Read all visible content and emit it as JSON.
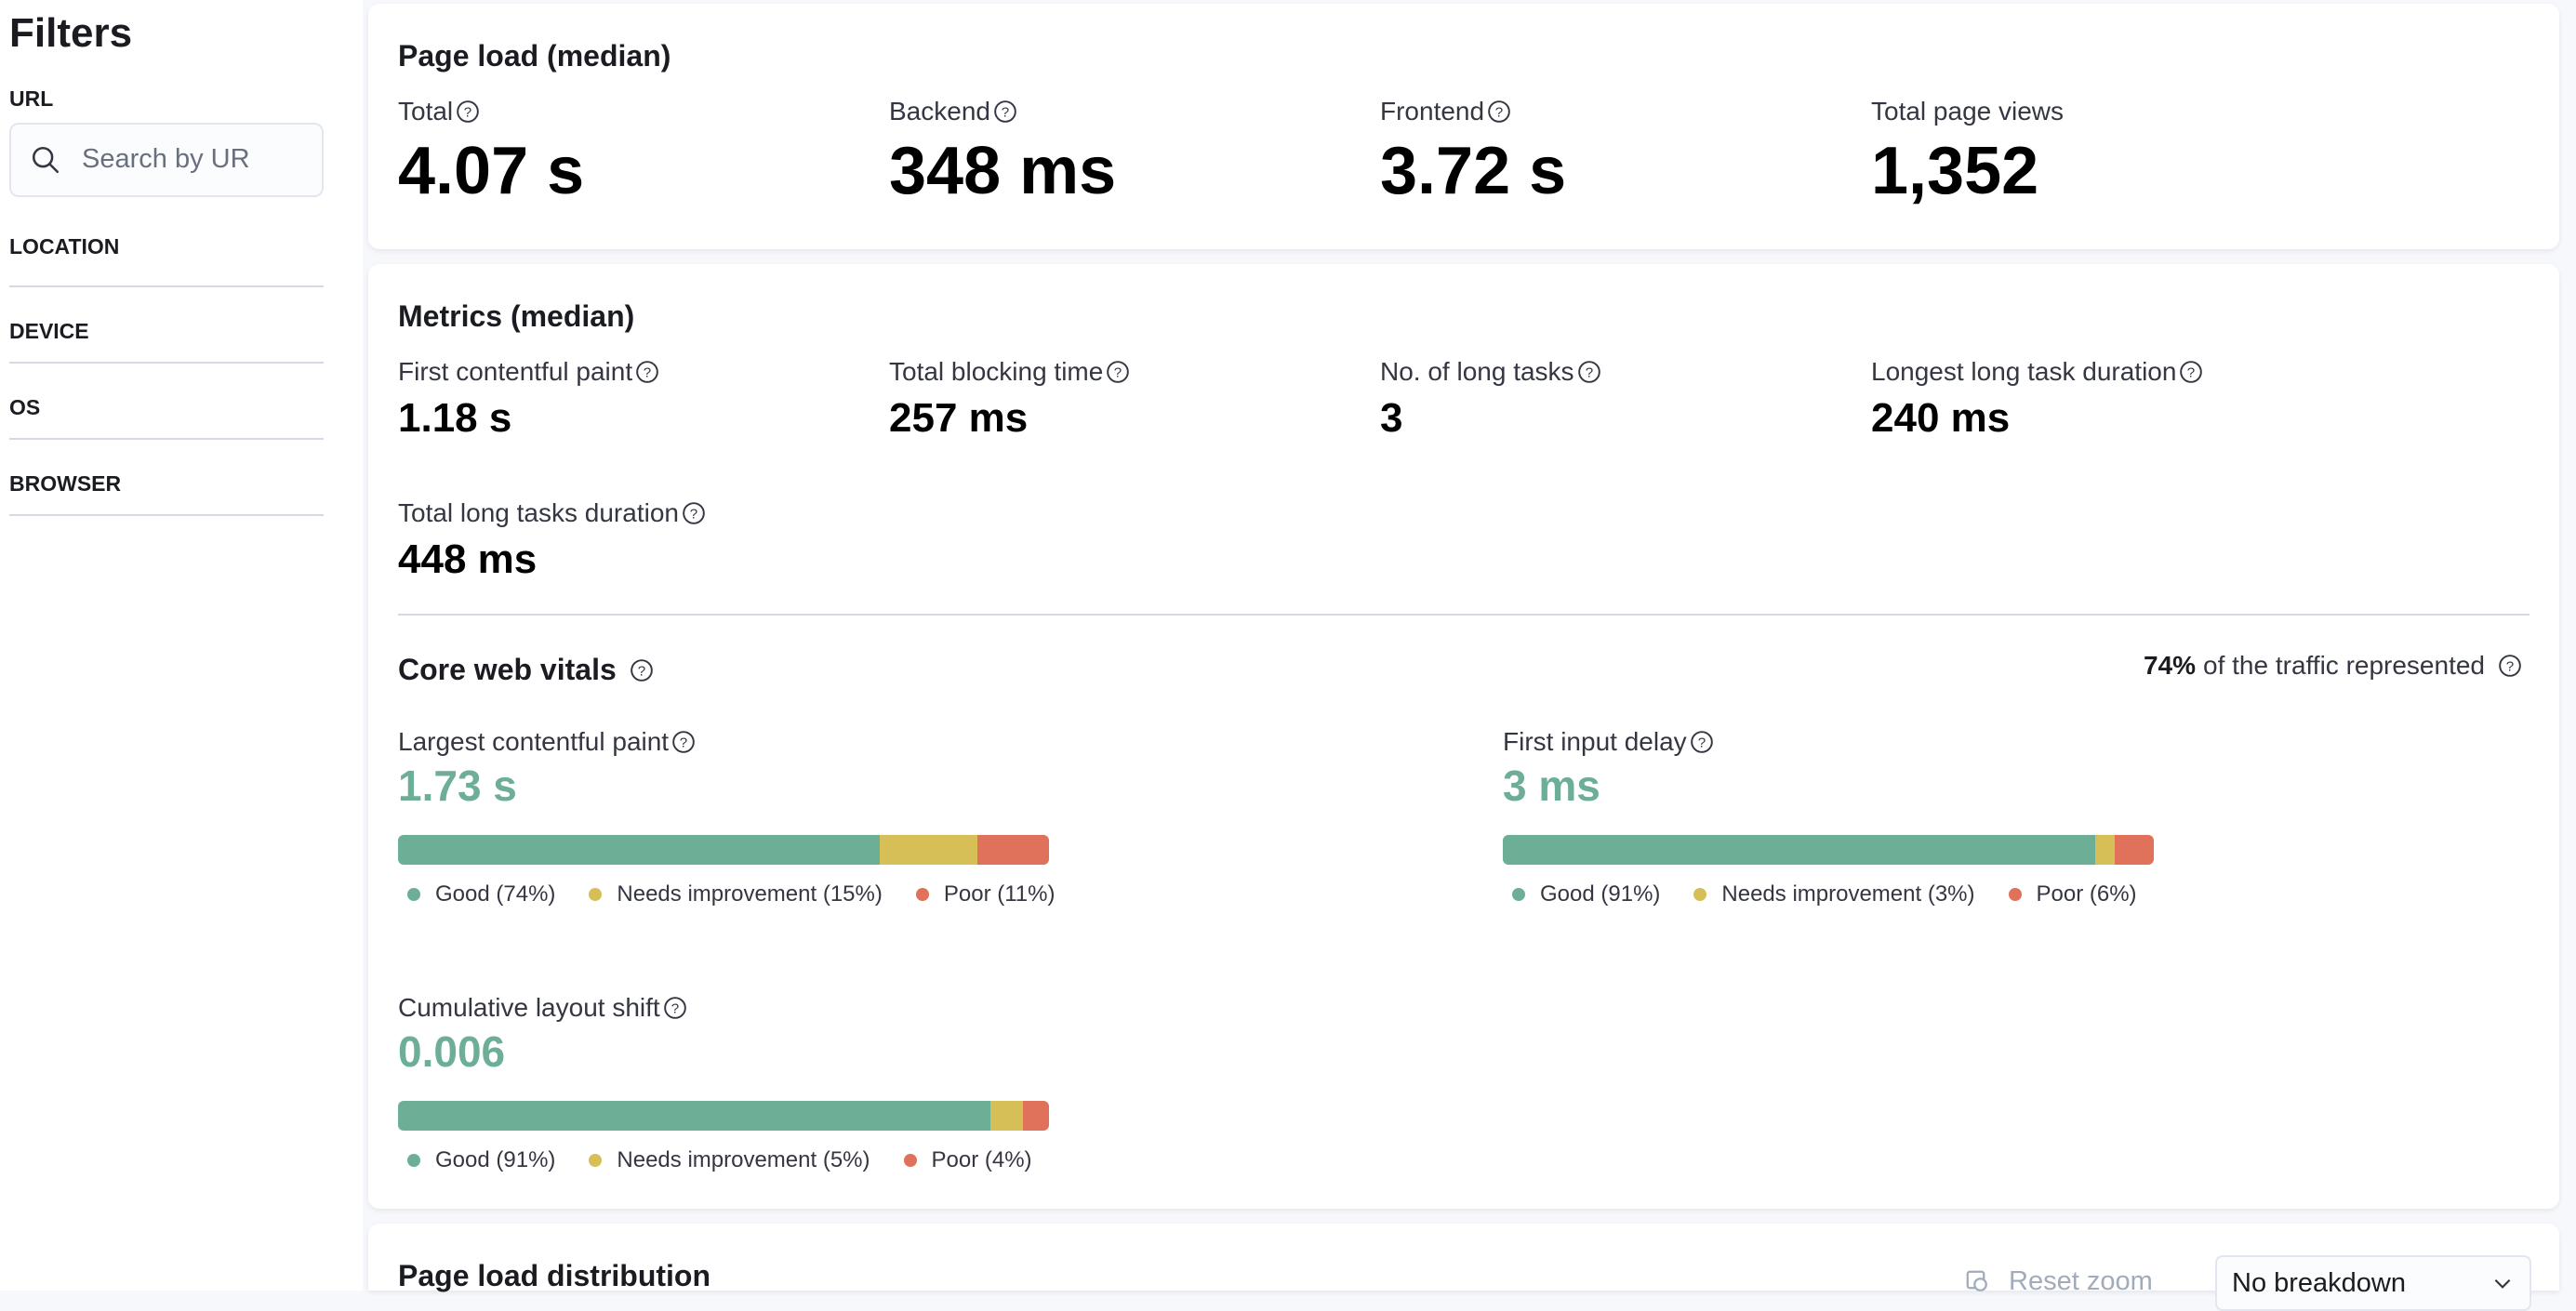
{
  "sidebar": {
    "title": "Filters",
    "url_label": "URL",
    "search_placeholder": "Search by URL",
    "groups": [
      "LOCATION",
      "DEVICE",
      "OS",
      "BROWSER"
    ]
  },
  "page_load": {
    "title": "Page load (median)",
    "stats": [
      {
        "label": "Total",
        "value": "4.07 s"
      },
      {
        "label": "Backend",
        "value": "348 ms"
      },
      {
        "label": "Frontend",
        "value": "3.72 s"
      },
      {
        "label": "Total page views",
        "value": "1,352"
      }
    ]
  },
  "metrics": {
    "title": "Metrics (median)",
    "stats": [
      {
        "label": "First contentful paint",
        "value": "1.18 s"
      },
      {
        "label": "Total blocking time",
        "value": "257 ms"
      },
      {
        "label": "No. of long tasks",
        "value": "3"
      },
      {
        "label": "Longest long task duration",
        "value": "240 ms"
      },
      {
        "label": "Total long tasks duration",
        "value": "448 ms"
      }
    ]
  },
  "core_web_vitals": {
    "title": "Core web vitals",
    "traffic_pct": "74%",
    "traffic_text": "of the traffic represented",
    "vitals": [
      {
        "label": "Largest contentful paint",
        "value": "1.73 s",
        "good_pct": 74,
        "ni_pct": 15,
        "poor_pct": 11,
        "good_label": "Good (74%)",
        "ni_label": "Needs improvement (15%)",
        "poor_label": "Poor (11%)"
      },
      {
        "label": "First input delay",
        "value": "3 ms",
        "good_pct": 91,
        "ni_pct": 3,
        "poor_pct": 6,
        "good_label": "Good (91%)",
        "ni_label": "Needs improvement (3%)",
        "poor_label": "Poor (6%)"
      },
      {
        "label": "Cumulative layout shift",
        "value": "0.006",
        "good_pct": 91,
        "ni_pct": 5,
        "poor_pct": 4,
        "good_label": "Good (91%)",
        "ni_label": "Needs improvement (5%)",
        "poor_label": "Poor (4%)"
      }
    ]
  },
  "distribution": {
    "title": "Page load distribution",
    "reset_zoom": "Reset zoom",
    "breakdown": "No breakdown"
  },
  "colors": {
    "good": "#6dae96",
    "needs_improvement": "#d6bf57",
    "poor": "#e0715a"
  }
}
